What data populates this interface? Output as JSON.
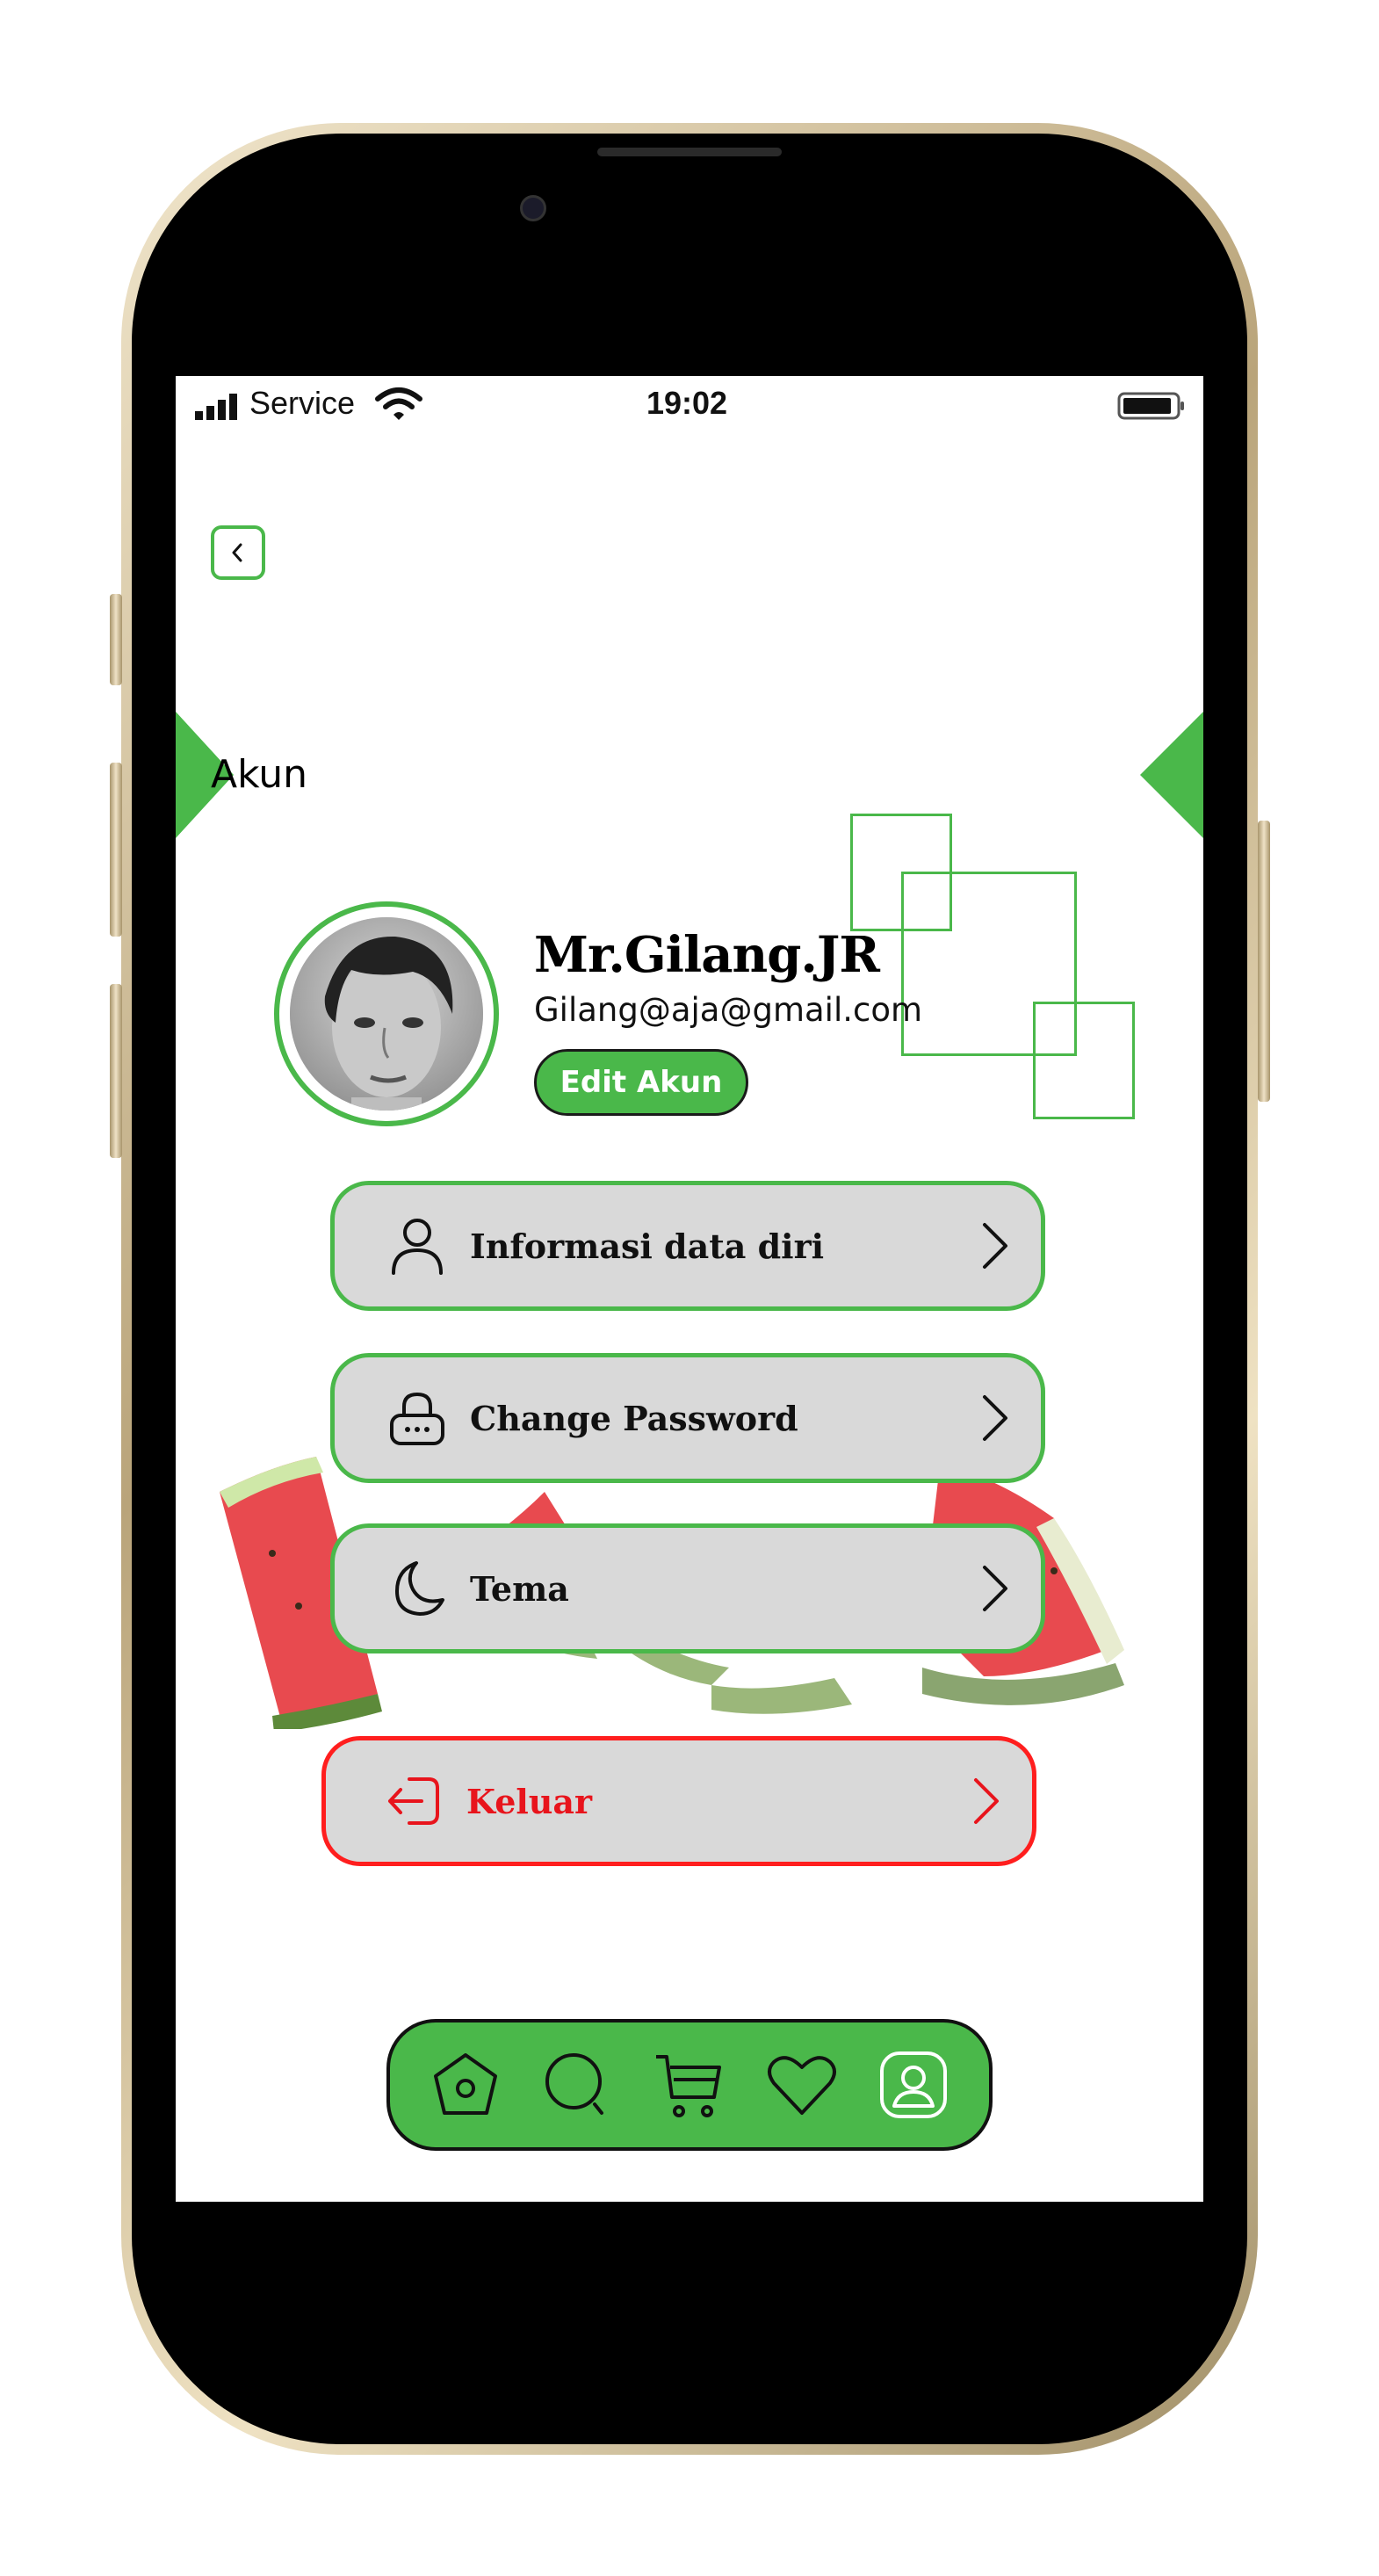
{
  "status_bar": {
    "carrier": "Service",
    "time": "19:02"
  },
  "page": {
    "title": "Akun"
  },
  "profile": {
    "name": "Mr.Gilang.JR",
    "email": "Gilang@aja@gmail.com",
    "edit_label": "Edit Akun"
  },
  "menu": [
    {
      "label": "Informasi data diri",
      "icon": "user-icon"
    },
    {
      "label": "Change Password",
      "icon": "lock-icon"
    },
    {
      "label": "Tema",
      "icon": "moon-icon"
    }
  ],
  "logout": {
    "label": "Keluar",
    "icon": "logout-icon"
  },
  "nav": [
    "home-icon",
    "search-icon",
    "cart-icon",
    "heart-icon",
    "profile-icon"
  ],
  "colors": {
    "accent": "#4ab84a",
    "danger": "#ff1e1e",
    "item_bg": "#d9d9d9"
  }
}
